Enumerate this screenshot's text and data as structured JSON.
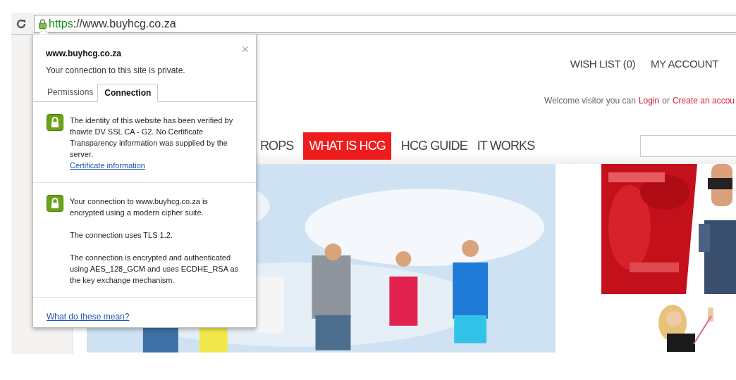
{
  "toolbar": {
    "url_scheme": "https",
    "url_rest": "://www.buyhcg.co.za",
    "secure": true
  },
  "site": {
    "top_links": [
      "WISH LIST (0)",
      "MY ACCOUNT"
    ],
    "welcome": {
      "text": "Welcome visitor you can",
      "login": "Login",
      "or": "or",
      "create": "Create an accou"
    },
    "menu": [
      {
        "label": "ROPS",
        "selected": false
      },
      {
        "label": "WHAT IS HCG",
        "selected": true
      },
      {
        "label": "HCG GUIDE",
        "selected": false
      },
      {
        "label": "IT WORKS",
        "selected": false
      }
    ],
    "pictures": [
      {
        "kind": "picture"
      },
      {
        "kind": "picture"
      },
      {
        "kind": "picture"
      },
      {
        "kind": "picture"
      }
    ]
  },
  "popup": {
    "site": "www.buyhcg.co.za",
    "subtitle": "Your connection to this site is private.",
    "close": "×",
    "tabs": [
      {
        "label": "Permissions",
        "selected": false
      },
      {
        "label": "Connection",
        "selected": true
      }
    ],
    "sections": [
      {
        "paragraphs": [
          "The identity of this website has been verified by thawte DV SSL CA - G2. No Certificate Transparency information was supplied by the server."
        ],
        "link": "Certificate information"
      },
      {
        "paragraphs": [
          "Your connection to www.buyhcg.co.za is encrypted using a modern cipher suite.",
          "The connection uses TLS 1.2.",
          "The connection is encrypted and authenticated using AES_128_GCM and uses ECDHE_RSA as the key exchange mechanism."
        ]
      }
    ],
    "help_link": "What do these mean?"
  }
}
